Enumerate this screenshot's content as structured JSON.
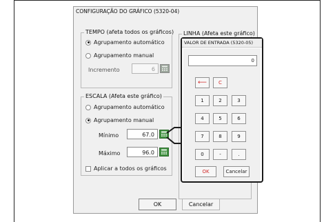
{
  "dialog": {
    "title": "CONFIGURAÇÃO DO GRÁFICO (5320-04)",
    "tempo": {
      "title": "TEMPO (afeta todos os gráficos)",
      "auto_label": "Agrupamento automático",
      "manual_label": "Agrupamento manual",
      "selected": "auto",
      "increment_label": "Incremento",
      "increment_value": "6"
    },
    "linha": {
      "title": "LINHA (Afeta este gráfico)"
    },
    "escala": {
      "title": "ESCALA (Afeta este gráfico)",
      "auto_label": "Agrupamento automático",
      "manual_label": "Agrupamento manual",
      "selected": "manual",
      "min_label": "Mínimo",
      "min_value": "67.0",
      "max_label": "Máximo",
      "max_value": "96.0",
      "apply_all_label": "Aplicar a todos os gráficos",
      "apply_all_checked": false
    },
    "ok_label": "OK",
    "cancel_label": "Cancelar"
  },
  "keypad": {
    "title": "VALOR DE ENTRADA (5320-05)",
    "display": "0",
    "backspace": "⟵",
    "clear": "C",
    "keys": [
      "1",
      "2",
      "3",
      "4",
      "5",
      "6",
      "7",
      "8",
      "9",
      "0",
      "-",
      "."
    ],
    "ok_label": "OK",
    "cancel_label": "Cancelar"
  },
  "colors": {
    "accent_red": "#d12a2a",
    "calc_button_green": "#3f8f3f",
    "highlight_border": "#1a1a1a"
  }
}
